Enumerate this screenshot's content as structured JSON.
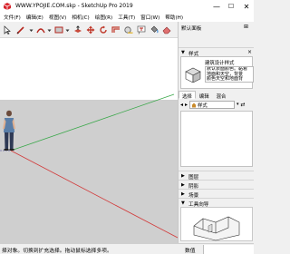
{
  "window": {
    "title": "WWW.YPOJIE.COM.skp - SketchUp Pro 2019",
    "minimize": "—",
    "maximize": "☐",
    "close": "✕"
  },
  "menu": {
    "items": [
      "文件(F)",
      "编辑(E)",
      "视图(V)",
      "相机(C)",
      "绘图(R)",
      "工具(T)",
      "窗口(W)",
      "帮助(H)"
    ]
  },
  "tray": {
    "title": "默认面板",
    "pin": "⊞",
    "styles_section": "样式",
    "style_name": "建筑设计样式",
    "style_description": "默认表面颜色。黏着\n地面和天空，背景\n颜色天空和地面背",
    "tabs": [
      "选择",
      "编辑",
      "混合"
    ],
    "combo_value": "样式",
    "collapsed_sections": [
      "图层",
      "阴影",
      "场景"
    ],
    "instructor_section": "工具向导"
  },
  "status": {
    "hint": "择对象。切换到扩充选择。拖动鼠标选择多项。",
    "measurement_label": "数值",
    "measurement_value": ""
  },
  "colors": {
    "red_axis": "#d23a3a",
    "green_axis": "#3aa84a",
    "sky": "#ffffff",
    "ground": "#cfcfcf"
  }
}
